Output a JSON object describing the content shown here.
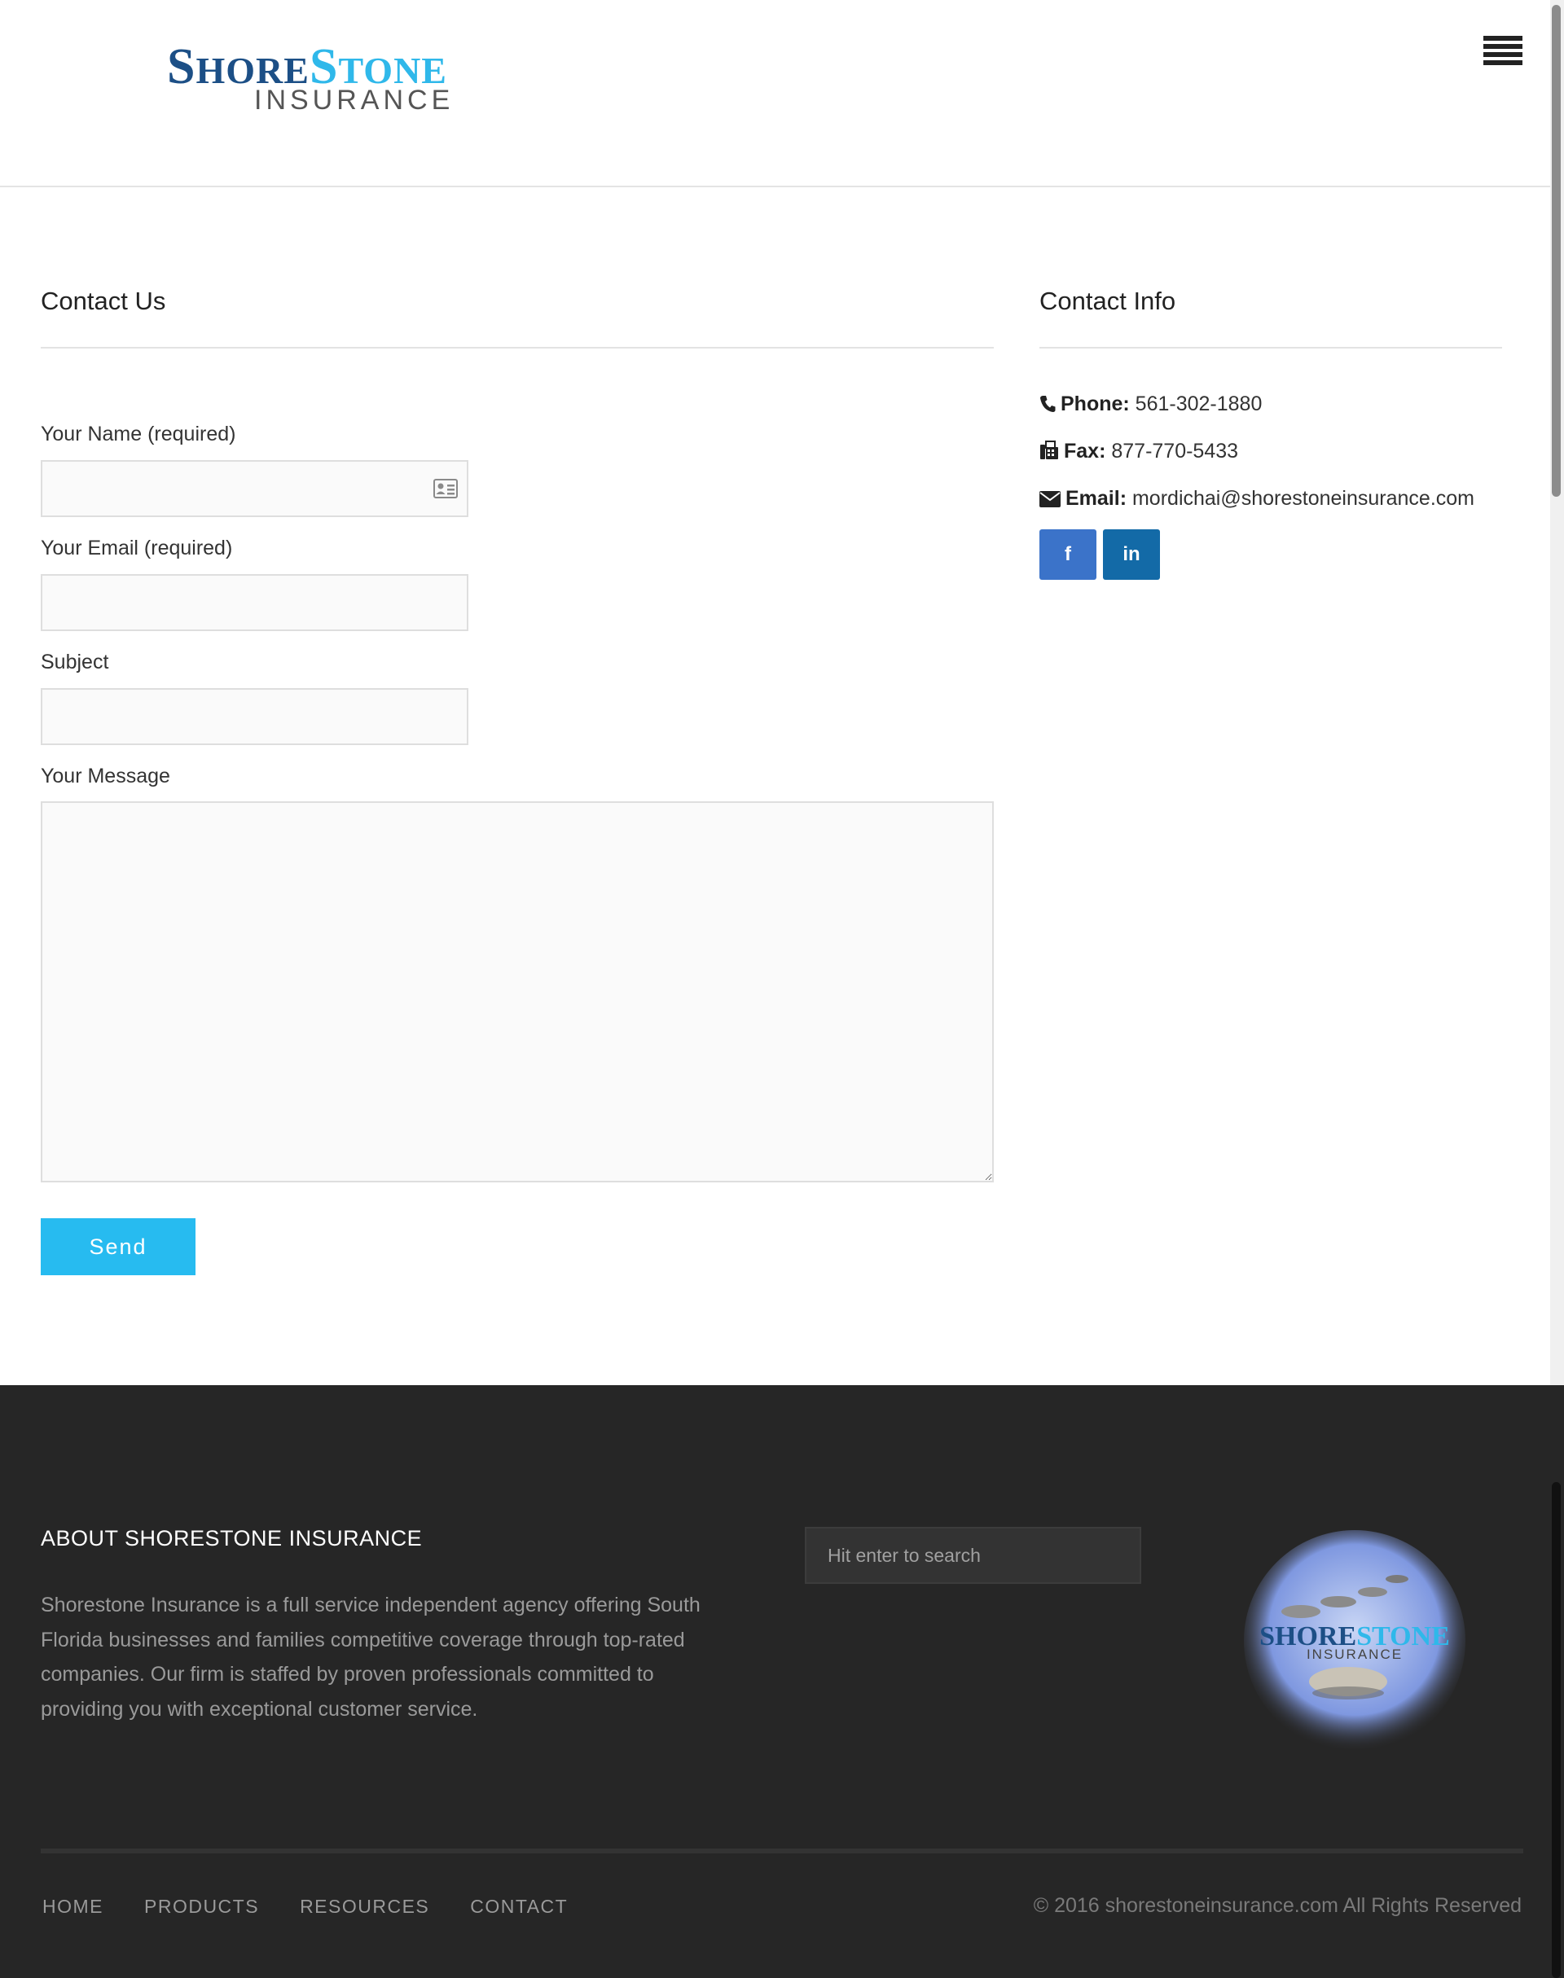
{
  "header": {
    "logo_shore_cap": "S",
    "logo_shore_rest": "HORE",
    "logo_stone_cap": "S",
    "logo_stone_rest": "TONE",
    "logo_sub": "INSURANCE"
  },
  "contact_form": {
    "title": "Contact Us",
    "name_label": "Your Name (required)",
    "email_label": "Your Email (required)",
    "subject_label": "Subject",
    "message_label": "Your Message",
    "name_value": "",
    "email_value": "",
    "subject_value": "",
    "message_value": "",
    "send_label": "Send"
  },
  "contact_info": {
    "title": "Contact Info",
    "phone_label": "Phone:",
    "phone_value": "561-302-1880",
    "fax_label": "Fax:",
    "fax_value": "877-770-5433",
    "email_label": "Email:",
    "email_value": "mordichai@shorestoneinsurance.com",
    "facebook_glyph": "f",
    "linkedin_glyph": "in"
  },
  "footer": {
    "about_title": "ABOUT SHORESTONE INSURANCE",
    "about_text": "Shorestone Insurance is a full service independent agency offering South Florida businesses and families competitive coverage through top-rated companies. Our firm is staffed by proven professionals committed to providing you with exceptional customer service.",
    "search_placeholder": "Hit enter to search",
    "logo_text_shore": "SHORE",
    "logo_text_stone": "STONE",
    "logo_text_sub": "INSURANCE",
    "nav": [
      "HOME",
      "PRODUCTS",
      "RESOURCES",
      "CONTACT"
    ],
    "copyright": "© 2016 shorestoneinsurance.com All Rights Reserved"
  },
  "colors": {
    "accent": "#27bbf0",
    "brand_navy": "#1c4f86",
    "footer_bg": "#262626",
    "facebook": "#3b73c9",
    "linkedin": "#136aa7"
  },
  "icons": [
    "menu-icon",
    "contact-card-icon",
    "phone-icon",
    "fax-icon",
    "envelope-icon",
    "facebook-icon",
    "linkedin-icon"
  ]
}
